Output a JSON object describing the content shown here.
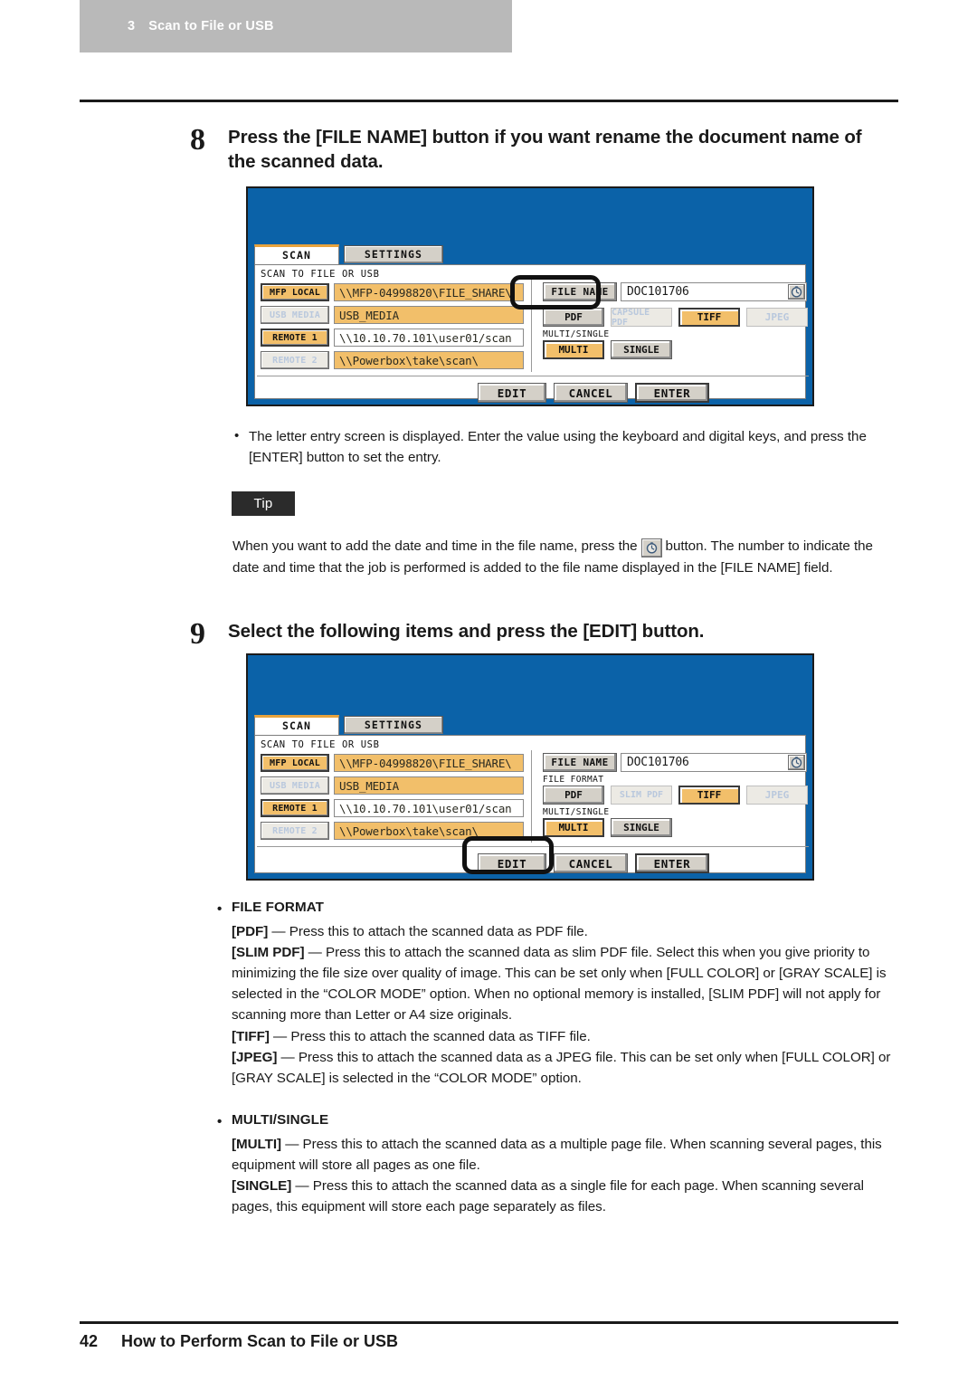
{
  "chapter": {
    "number": "3",
    "title": "Scan to File or USB"
  },
  "steps": [
    {
      "number": "8",
      "text": "Press the [FILE NAME] button if you want rename the document name of the scanned data."
    },
    {
      "number": "9",
      "text": "Select the following items and press the [EDIT] button."
    }
  ],
  "screen1": {
    "tabs": {
      "active": "SCAN",
      "idle": "SETTINGS"
    },
    "section_title": "SCAN TO FILE OR USB",
    "sources": [
      {
        "button": "MFP LOCAL",
        "state": "on",
        "path": "\\\\MFP-04998820\\FILE_SHARE\\",
        "field": "amber"
      },
      {
        "button": "USB MEDIA",
        "state": "off",
        "path": "USB_MEDIA",
        "field": "amber"
      },
      {
        "button": "REMOTE 1",
        "state": "on",
        "path": "\\\\10.10.70.101\\user01/scan",
        "field": "white"
      },
      {
        "button": "REMOTE 2",
        "state": "off",
        "path": "\\\\Powerbox\\take\\scan\\",
        "field": "amber"
      }
    ],
    "file_name_button": "FILE NAME",
    "file_name_value": "DOC101706",
    "clock_icon": "clock-icon",
    "file_format_label": "",
    "formats": [
      {
        "label": "PDF",
        "state": "normal"
      },
      {
        "label": "CAPSULE PDF",
        "state": "disabled"
      },
      {
        "label": "TIFF",
        "state": "selected"
      },
      {
        "label": "JPEG",
        "state": "disabled"
      }
    ],
    "multisingle_label": "MULTI/SINGLE",
    "multisingle": [
      {
        "label": "MULTI",
        "state": "selected"
      },
      {
        "label": "SINGLE",
        "state": "normal"
      }
    ],
    "actions": [
      {
        "label": "EDIT",
        "state": "normal"
      },
      {
        "label": "CANCEL",
        "state": "normal"
      },
      {
        "label": "ENTER",
        "state": "default"
      }
    ],
    "highlight": "file-name-button"
  },
  "screen2": {
    "tabs": {
      "active": "SCAN",
      "idle": "SETTINGS"
    },
    "section_title": "SCAN TO FILE OR USB",
    "sources": [
      {
        "button": "MFP LOCAL",
        "state": "on",
        "path": "\\\\MFP-04998820\\FILE_SHARE\\",
        "field": "amber"
      },
      {
        "button": "USB MEDIA",
        "state": "off",
        "path": "USB_MEDIA",
        "field": "amber"
      },
      {
        "button": "REMOTE 1",
        "state": "on",
        "path": "\\\\10.10.70.101\\user01/scan",
        "field": "white"
      },
      {
        "button": "REMOTE 2",
        "state": "off",
        "path": "\\\\Powerbox\\take\\scan\\",
        "field": "amber"
      }
    ],
    "file_name_button": "FILE NAME",
    "file_name_value": "DOC101706",
    "clock_icon": "clock-icon",
    "file_format_label": "FILE FORMAT",
    "formats": [
      {
        "label": "PDF",
        "state": "normal"
      },
      {
        "label": "SLIM PDF",
        "state": "disabled"
      },
      {
        "label": "TIFF",
        "state": "selected"
      },
      {
        "label": "JPEG",
        "state": "disabled"
      }
    ],
    "multisingle_label": "MULTI/SINGLE",
    "multisingle": [
      {
        "label": "MULTI",
        "state": "selected"
      },
      {
        "label": "SINGLE",
        "state": "normal"
      }
    ],
    "actions": [
      {
        "label": "EDIT",
        "state": "normal"
      },
      {
        "label": "CANCEL",
        "state": "normal"
      },
      {
        "label": "ENTER",
        "state": "default"
      }
    ],
    "highlight": "edit-button"
  },
  "note_bullet": "The letter entry screen is displayed.  Enter the value using the keyboard and digital keys, and press the [ENTER] button to set the entry.",
  "tip": {
    "badge": "Tip",
    "text_before": "When you want to add the date and time in the file name, press the",
    "text_after": "button.   The number to indicate the date and time that the job is performed is added to the file name displayed in the [FILE NAME] field."
  },
  "definitions": [
    {
      "heading": "FILE FORMAT",
      "items": [
        {
          "term": "[PDF]",
          "dash": " — ",
          "desc": "Press this to attach the scanned data as PDF file."
        },
        {
          "term": "[SLIM PDF]",
          "dash": " — ",
          "desc": "Press this to attach the scanned data as slim PDF file.  Select this when you give priority to minimizing the file size over quality of image.  This can be set only when [FULL COLOR] or [GRAY SCALE] is selected in the “COLOR MODE” option.  When no optional memory is installed, [SLIM PDF] will not apply for scanning more than Letter or A4 size originals."
        },
        {
          "term": "[TIFF]",
          "dash": " — ",
          "desc": "Press this to attach the scanned data as TIFF file."
        },
        {
          "term": "[JPEG]",
          "dash": " — ",
          "desc": "Press this to attach the scanned data as a JPEG file.  This can be set only when [FULL COLOR] or [GRAY SCALE] is selected in the “COLOR MODE” option."
        }
      ]
    },
    {
      "heading": "MULTI/SINGLE",
      "items": [
        {
          "term": "[MULTI]",
          "dash": " — ",
          "desc": "Press this to attach the scanned data as a multiple page file.  When scanning several pages, this equipment will store all pages as one file."
        },
        {
          "term": "[SINGLE]",
          "dash": " — ",
          "desc": "Press this to attach the scanned data as a single file for each page.  When scanning several pages, this equipment will store each page separately as files."
        }
      ]
    }
  ],
  "footer": {
    "page": "42",
    "title": "How to Perform Scan to File or USB"
  },
  "colors": {
    "chapter_tab_bg": "#b9b9b9",
    "lcd_blue": "#0b62a8",
    "amber": "#f2bf6a",
    "button_grey": "#d4d0c8",
    "tip_badge": "#2b2b2b"
  }
}
